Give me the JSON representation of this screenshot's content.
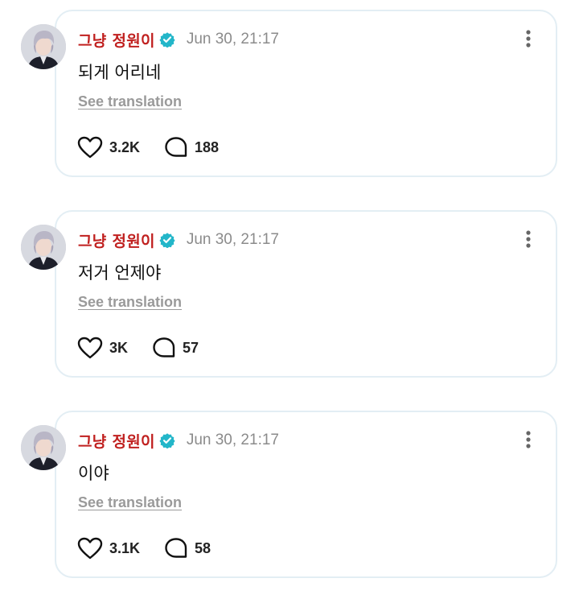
{
  "posts": [
    {
      "author": "그냥 정원이",
      "time": "Jun 30, 21:17",
      "text": "되게 어리네",
      "translate_label": "See translation",
      "likes": "3.2K",
      "comments": "188"
    },
    {
      "author": "그냥 정원이",
      "time": "Jun 30, 21:17",
      "text": "저거 언제야",
      "translate_label": "See translation",
      "likes": "3K",
      "comments": "57"
    },
    {
      "author": "그냥 정원이",
      "time": "Jun 30, 21:17",
      "text": "이야",
      "translate_label": "See translation",
      "likes": "3.1K",
      "comments": "58"
    }
  ],
  "colors": {
    "author": "#c0201f",
    "verified_badge": "#23b6c9",
    "timestamp": "#8b8b8b",
    "card_border": "#e3eef4",
    "translation_link": "#9a9a9a"
  },
  "icons": {
    "verified": "verified-badge-icon",
    "more": "more-vertical-icon",
    "like": "heart-icon",
    "comment": "comment-bubble-icon"
  }
}
